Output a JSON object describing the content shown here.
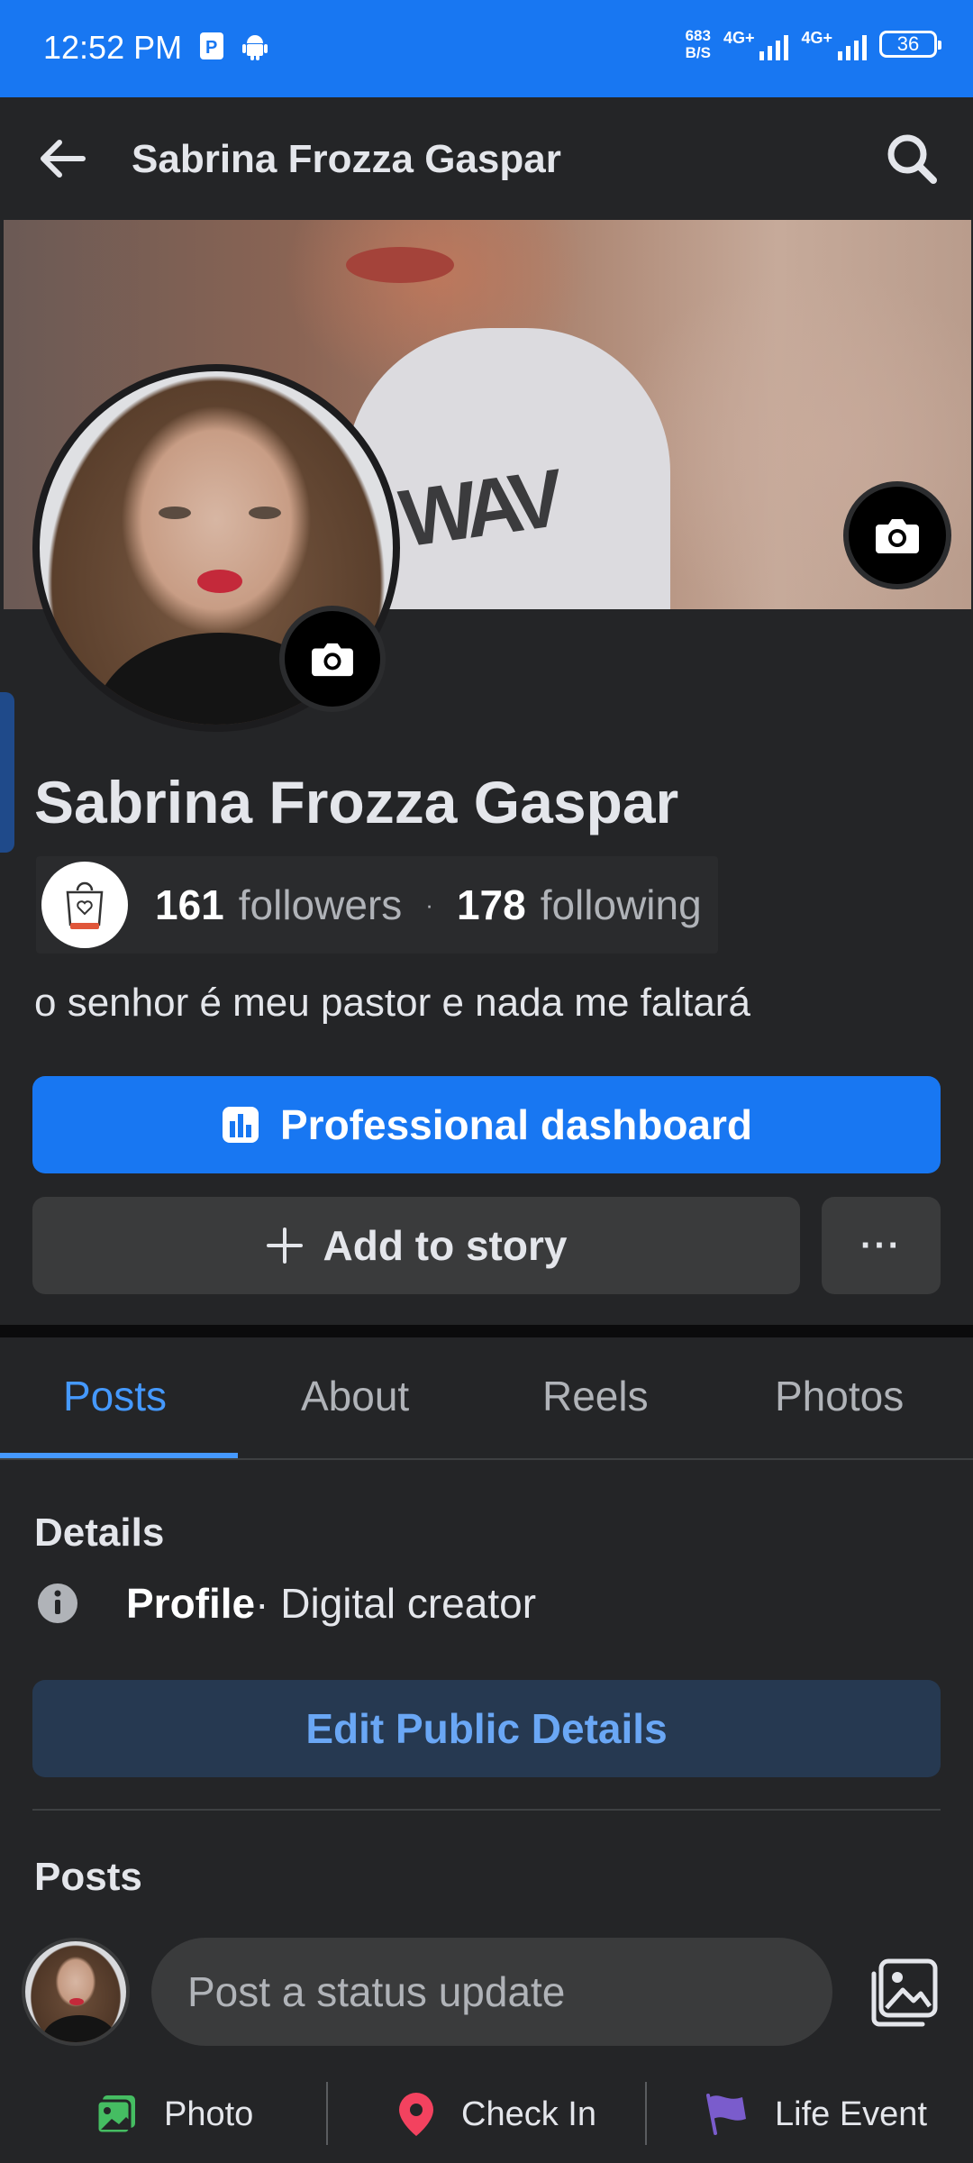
{
  "status_bar": {
    "time": "12:52 PM",
    "net_speed_value": "683",
    "net_speed_unit": "B/S",
    "signal1_label": "4G+",
    "signal2_label": "4G+",
    "battery": "36"
  },
  "header": {
    "title": "Sabrina Frozza Gaspar",
    "back_icon": "arrow-left-icon",
    "search_icon": "search-icon"
  },
  "cover": {
    "shirt_text": "WAV"
  },
  "profile": {
    "name": "Sabrina Frozza Gaspar",
    "followers_count": "161",
    "followers_label": "followers",
    "separator": "·",
    "following_count": "178",
    "following_label": "following",
    "bio": "o senhor é meu pastor e nada me faltará"
  },
  "buttons": {
    "dashboard": "Professional dashboard",
    "add_story": "Add to story",
    "more": "···"
  },
  "tabs": [
    {
      "label": "Posts",
      "active": true
    },
    {
      "label": "About",
      "active": false
    },
    {
      "label": "Reels",
      "active": false
    },
    {
      "label": "Photos",
      "active": false
    }
  ],
  "details": {
    "heading": "Details",
    "profile_strong": "Profile",
    "profile_rest": " · Digital creator",
    "edit_button": "Edit Public Details"
  },
  "posts": {
    "heading": "Posts",
    "status_placeholder": "Post a status update"
  },
  "actions": {
    "photo": "Photo",
    "checkin": "Check In",
    "life_event": "Life Event"
  },
  "colors": {
    "accent": "#1877f2",
    "background": "#242527",
    "button_secondary": "#3a3b3c",
    "tab_active": "#4599ff",
    "photo_icon": "#45bd62",
    "checkin_icon": "#f3425f",
    "life_event_icon": "#7a5ccc"
  }
}
